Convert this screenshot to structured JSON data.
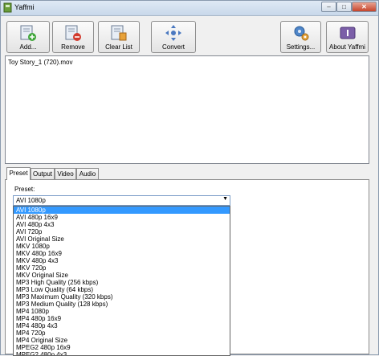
{
  "window": {
    "title": "Yaffmi"
  },
  "toolbar": {
    "add_label": "Add...",
    "remove_label": "Remove",
    "clear_label": "Clear List",
    "convert_label": "Convert",
    "settings_label": "Settings...",
    "about_label": "About Yaffmi"
  },
  "files": [
    "Toy Story_1 (720).mov"
  ],
  "tabs": [
    "Preset",
    "Output",
    "Video",
    "Audio"
  ],
  "preset": {
    "label": "Preset:",
    "selected": "AVI 1080p",
    "options": [
      "AVI 1080p",
      "AVI 480p 16x9",
      "AVI 480p 4x3",
      "AVI 720p",
      "AVI Original Size",
      "MKV 1080p",
      "MKV 480p 16x9",
      "MKV 480p 4x3",
      "MKV 720p",
      "MKV Original Size",
      "MP3 High Quality (256 kbps)",
      "MP3 Low Quality (64 kbps)",
      "MP3 Maximum Quality (320 kbps)",
      "MP3 Medium Quality (128 kbps)",
      "MP4 1080p",
      "MP4 480p 16x9",
      "MP4 480p 4x3",
      "MP4 720p",
      "MP4 Original Size",
      "MPEG2 480p 16x9",
      "MPEG2 480p 4x3"
    ]
  },
  "colors": {
    "selection": "#3399ff",
    "titlebar": "#c8d8ea"
  }
}
